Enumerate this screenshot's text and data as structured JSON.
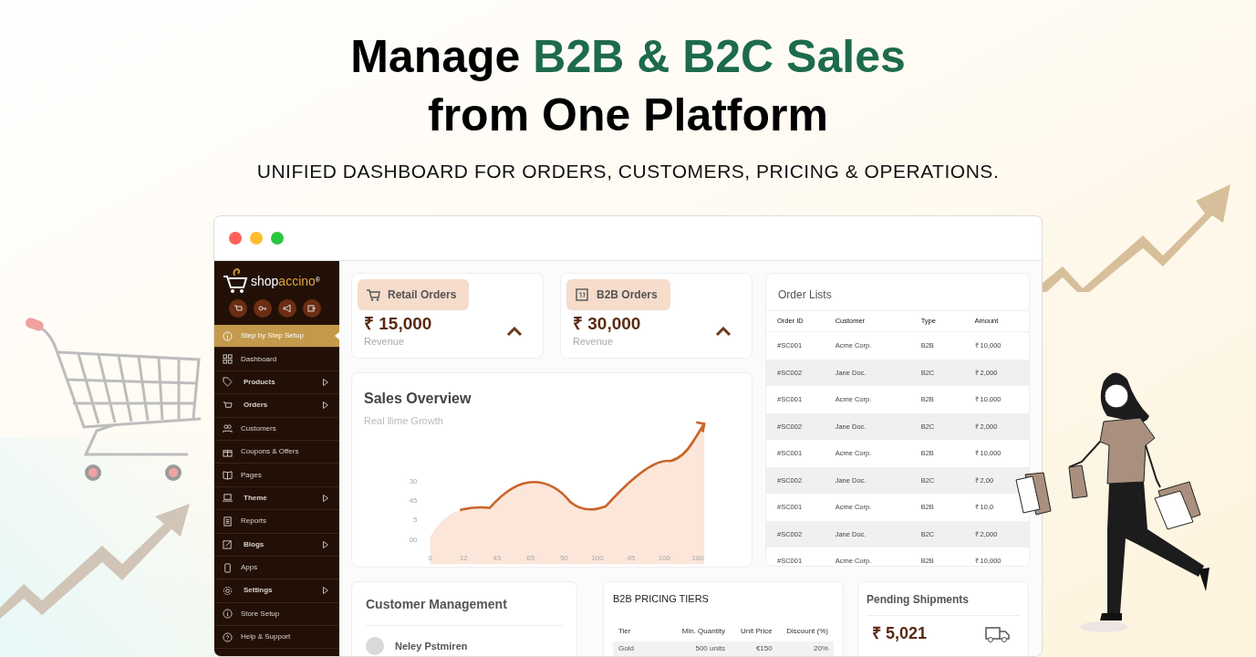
{
  "headline": {
    "lead": "Manage",
    "highlight": "B2B & B2C Sales",
    "line_2": "from One Platform"
  },
  "subtitle": "UNIFIED DASHBOARD FOR ORDERS, CUSTOMERS, PRICING & OPERATIONS.",
  "sidebar": {
    "logo": {
      "prefix": "shop",
      "suffix": "accino",
      "mark": "®"
    },
    "items": [
      {
        "label": "Step by Step Setup",
        "selected": true,
        "has_submenu": false
      },
      {
        "label": "Dashboard",
        "selected": false,
        "has_submenu": false
      },
      {
        "label": "Products",
        "selected": false,
        "has_submenu": true
      },
      {
        "label": "Orders",
        "selected": false,
        "has_submenu": true
      },
      {
        "label": "Customers",
        "selected": false,
        "has_submenu": false
      },
      {
        "label": "Coupons & Offers",
        "selected": false,
        "has_submenu": false
      },
      {
        "label": "Pages",
        "selected": false,
        "has_submenu": false
      },
      {
        "label": "Theme",
        "selected": false,
        "has_submenu": true
      },
      {
        "label": "Reports",
        "selected": false,
        "has_submenu": false
      },
      {
        "label": "Blogs",
        "selected": false,
        "has_submenu": true
      },
      {
        "label": "Apps",
        "selected": false,
        "has_submenu": false
      },
      {
        "label": "Settings",
        "selected": false,
        "has_submenu": true
      },
      {
        "label": "Store Setup",
        "selected": false,
        "has_submenu": false
      },
      {
        "label": "Help & Support",
        "selected": false,
        "has_submenu": false
      }
    ]
  },
  "stat_cards": [
    {
      "kind": "retail",
      "title": "Retail Orders",
      "value": "₹ 15,000",
      "caption": "Revenue"
    },
    {
      "kind": "b2b",
      "title": "B2B Orders",
      "value": "₹ 30,000",
      "caption": "Revenue"
    }
  ],
  "sales_overview": {
    "title": "Sales Overview",
    "subtitle": "Real llime Growth",
    "y_labels": [
      "30",
      "45",
      "5",
      "00"
    ],
    "x_labels": [
      "0",
      "12",
      "45",
      "65",
      "50",
      "100",
      "45",
      "100",
      "180"
    ]
  },
  "order_list": {
    "title": "Order Lists",
    "columns": [
      "Order ID",
      "Customer",
      "Type",
      "Amount"
    ],
    "rows": [
      [
        "#SC001",
        "Acme Corp.",
        "B2B",
        "₹ 10,000"
      ],
      [
        "#SC002",
        "Jane Doc.",
        "B2C",
        "₹ 2,000"
      ],
      [
        "#SC001",
        "Acme Corp.",
        "B2B",
        "₹ 10,000"
      ],
      [
        "#SC002",
        "Jane Doc.",
        "B2C",
        "₹ 2,000"
      ],
      [
        "#SC001",
        "Acme Corp.",
        "B2B",
        "₹ 10,000"
      ],
      [
        "#SC002",
        "Jane Doc.",
        "B2C",
        "₹ 2,00"
      ],
      [
        "#SC001",
        "Acme Corp.",
        "B2B",
        "₹ 10,0"
      ],
      [
        "#SC002",
        "Jane Doc.",
        "B2C",
        "₹ 2,000"
      ],
      [
        "#SC001",
        "Acme Corp.",
        "B2B",
        "₹ 10,000"
      ]
    ]
  },
  "customer_management": {
    "title": "Customer Management",
    "customers": [
      {
        "name": "Neley Pstmiren"
      }
    ]
  },
  "pricing_tiers": {
    "title": "B2B PRICING TIERS",
    "columns": [
      "Tier",
      "Min. Quantity",
      "Unit Price",
      "Discount (%)"
    ],
    "rows": [
      [
        "Gold",
        "500 units",
        "€150",
        "20%"
      ]
    ]
  },
  "pending_shipments": {
    "title": "Pending Shipments",
    "value": "₹ 5,021"
  }
}
